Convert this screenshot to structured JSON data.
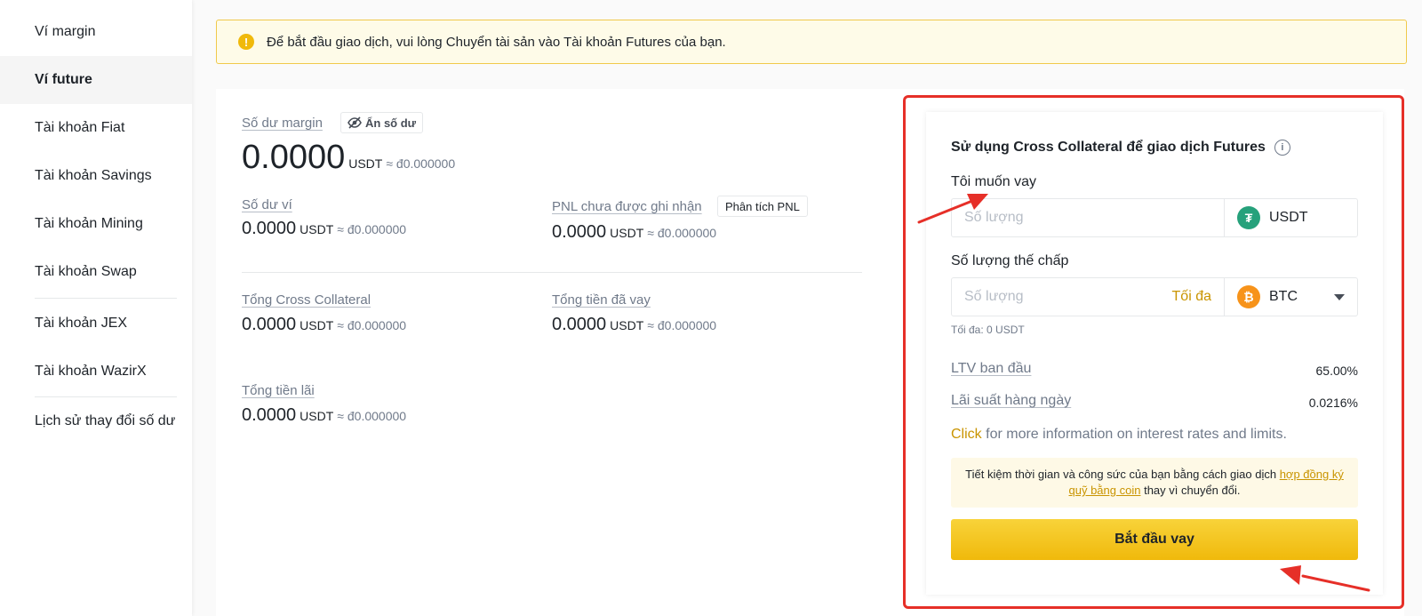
{
  "sidebar": {
    "items": [
      {
        "label": "Ví margin"
      },
      {
        "label": "Ví future"
      },
      {
        "label": "Tài khoản Fiat"
      },
      {
        "label": "Tài khoản Savings"
      },
      {
        "label": "Tài khoản Mining"
      },
      {
        "label": "Tài khoản Swap"
      },
      {
        "label": "Tài khoản JEX"
      },
      {
        "label": "Tài khoản WazirX"
      },
      {
        "label": "Lịch sử thay đổi số dư"
      }
    ]
  },
  "alert": {
    "text": "Để bắt đầu giao dịch, vui lòng Chuyển tài sản vào Tài khoản Futures của bạn."
  },
  "balance": {
    "margin_label": "Số dư margin",
    "hide_label": "Ẩn số dư",
    "margin_amount": "0.0000",
    "unit": "USDT",
    "approx": "≈ đ0.000000",
    "wallet_label": "Số dư ví",
    "wallet_amount": "0.0000",
    "pnl_label": "PNL chưa được ghi nhận",
    "pnl_btn": "Phân tích PNL",
    "pnl_amount": "0.0000",
    "cross_label": "Tổng Cross Collateral",
    "cross_amount": "0.0000",
    "borrowed_label": "Tổng tiền đã vay",
    "borrowed_amount": "0.0000",
    "interest_label": "Tổng tiền lãi",
    "interest_amount": "0.0000"
  },
  "borrow": {
    "title": "Sử dụng Cross Collateral để giao dịch Futures",
    "want_label": "Tôi muốn vay",
    "amount_placeholder": "Số lượng",
    "borrow_coin": "USDT",
    "collateral_label": "Số lượng thế chấp",
    "max_label": "Tối đa",
    "collateral_coin": "BTC",
    "max_note": "Tối đa: 0 USDT",
    "ltv_label": "LTV ban đầu",
    "ltv_value": "65.00%",
    "rate_label": "Lãi suất hàng ngày",
    "rate_value": "0.0216%",
    "click_link": "Click",
    "more_info": "for more information on interest rates and limits.",
    "tip_text": "Tiết kiệm thời gian và công sức của bạn bằng cách giao dịch",
    "tip_link": "hợp đồng ký quỹ bằng coin",
    "tip_tail": "thay vì chuyển đổi.",
    "start_btn": "Bắt đầu vay"
  },
  "colors": {
    "accent": "#f0b90b",
    "highlight": "#e62f28",
    "link": "#c99400"
  }
}
